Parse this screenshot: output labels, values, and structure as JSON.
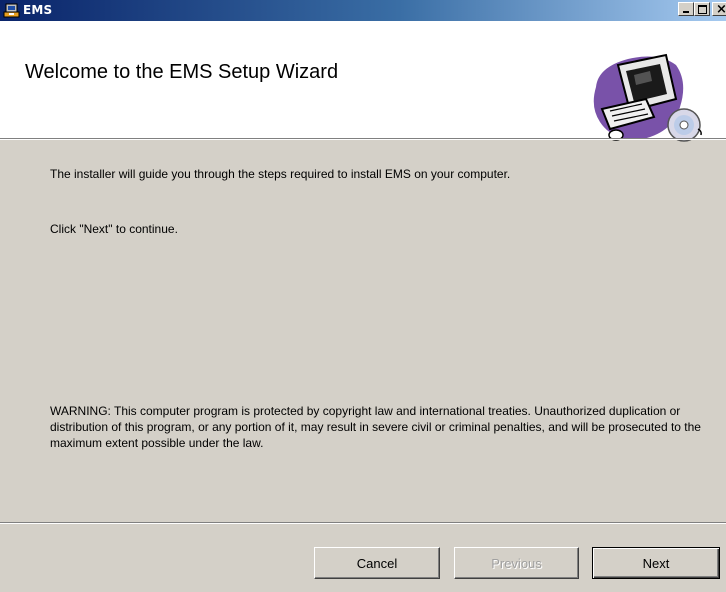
{
  "window": {
    "title": "EMS",
    "icon": "installer-icon",
    "controls": {
      "minimize": "minimize",
      "maximize": "maximize",
      "close": "×"
    }
  },
  "banner": {
    "title": "Welcome to the EMS Setup Wizard",
    "art_icon": "computer-cd-icon"
  },
  "content": {
    "intro": "The installer will guide you through the steps required to install EMS on your computer.",
    "next_hint": "Click \"Next\" to continue.",
    "warning": "WARNING: This computer program is protected by copyright law and international treaties. Unauthorized duplication or distribution of this program, or any portion of it, may result in severe civil or criminal penalties, and will be prosecuted to the maximum extent possible under the law."
  },
  "buttons": {
    "cancel": "Cancel",
    "previous": "Previous",
    "next": "Next",
    "previous_enabled": false
  },
  "colors": {
    "titlebar_start": "#0a246a",
    "titlebar_end": "#a6caf0",
    "dialog_bg": "#d4d0c8",
    "banner_bg": "#ffffff"
  }
}
